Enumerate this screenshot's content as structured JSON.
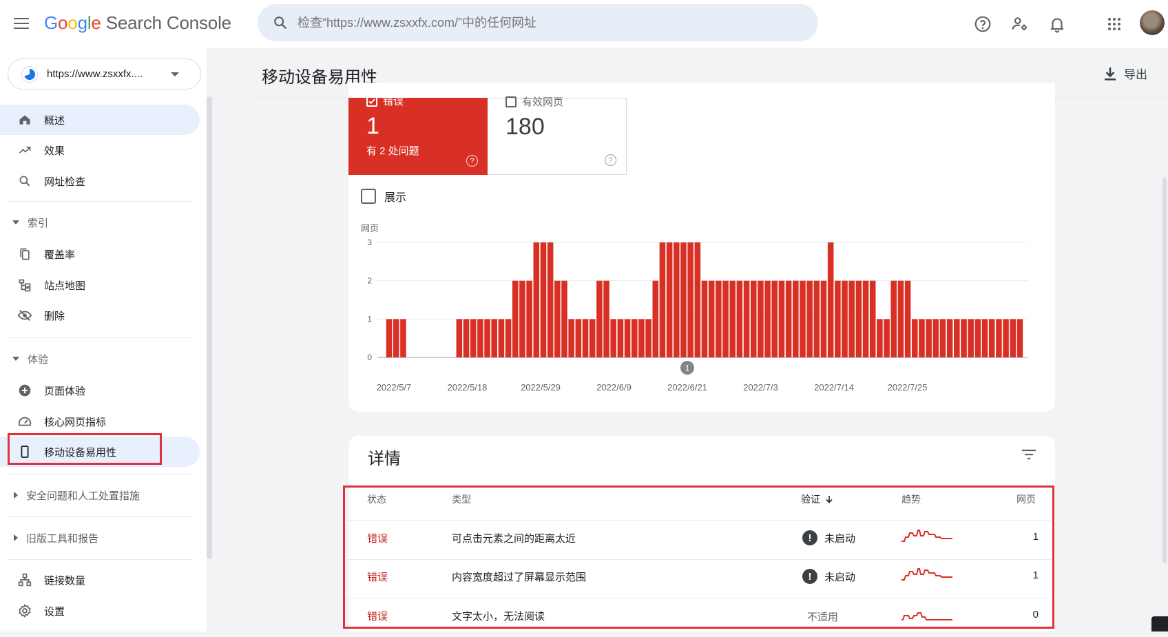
{
  "header": {
    "logo_google": [
      "G",
      "o",
      "o",
      "g",
      "l",
      "e"
    ],
    "logo_product": "Search Console",
    "search_placeholder": "检查“https://www.zsxxfx.com/”中的任何网址",
    "icons": [
      "help-icon",
      "manage-users-icon",
      "notifications-icon",
      "apps-icon"
    ]
  },
  "sidebar": {
    "property": "https://www.zsxxfx....",
    "items": [
      {
        "label": "概述",
        "icon": "home-icon"
      },
      {
        "label": "效果",
        "icon": "trending-up-icon"
      },
      {
        "label": "网址检查",
        "icon": "search-icon"
      }
    ],
    "section_index": {
      "label": "索引",
      "items": [
        {
          "label": "覆盖率",
          "icon": "copy-icon"
        },
        {
          "label": "站点地图",
          "icon": "sitemap-icon"
        },
        {
          "label": "删除",
          "icon": "visibility-off-icon"
        }
      ]
    },
    "section_experience": {
      "label": "体验",
      "items": [
        {
          "label": "页面体验",
          "icon": "add-circle-icon"
        },
        {
          "label": "核心网页指标",
          "icon": "speed-icon"
        },
        {
          "label": "移动设备易用性",
          "icon": "smartphone-icon"
        }
      ]
    },
    "section_security": "安全问题和人工处置措施",
    "section_legacy": "旧版工具和报告",
    "footer_items": [
      {
        "label": "链接数量",
        "icon": "links-icon"
      },
      {
        "label": "设置",
        "icon": "settings-icon"
      }
    ]
  },
  "main": {
    "title": "移动设备易用性",
    "export_label": "导出",
    "tiles": {
      "error": {
        "label": "错误",
        "value": "1",
        "sub": "有 2 处问题",
        "checked": true
      },
      "valid": {
        "label": "有效网页",
        "value": "180",
        "checked": false
      }
    },
    "show_label": "展示",
    "details_title": "详情"
  },
  "chart_data": {
    "type": "bar",
    "ylabel": "网页",
    "ylim": [
      0,
      3
    ],
    "yticks": [
      0,
      1,
      2,
      3
    ],
    "x_tick_labels": [
      "2022/5/7",
      "2022/5/18",
      "2022/5/29",
      "2022/6/9",
      "2022/6/21",
      "2022/7/3",
      "2022/7/14",
      "2022/7/25"
    ],
    "annotation": "1",
    "series": [
      {
        "color": "#d93025",
        "values": [
          1,
          1,
          1,
          0,
          0,
          0,
          0,
          0,
          0,
          0,
          1,
          1,
          1,
          1,
          1,
          1,
          1,
          1,
          2,
          2,
          2,
          3,
          3,
          3,
          2,
          2,
          1,
          1,
          1,
          1,
          2,
          2,
          1,
          1,
          1,
          1,
          1,
          1,
          2,
          3,
          3,
          3,
          3,
          3,
          3,
          2,
          2,
          2,
          2,
          2,
          2,
          2,
          2,
          2,
          2,
          2,
          2,
          2,
          2,
          2,
          2,
          2,
          2,
          3,
          2,
          2,
          2,
          2,
          2,
          2,
          1,
          1,
          2,
          2,
          2,
          1,
          1,
          1,
          1,
          1,
          1,
          1,
          1,
          1,
          1,
          1,
          1,
          1,
          1,
          1,
          1
        ]
      }
    ]
  },
  "table": {
    "headers": {
      "status": "状态",
      "type": "类型",
      "verify": "验证",
      "trend": "趋势",
      "pages": "网页"
    },
    "rows": [
      {
        "status": "错误",
        "type": "可点击元素之间的距离太近",
        "verify": "未启动",
        "verify_icon": true,
        "pages": "1"
      },
      {
        "status": "错误",
        "type": "内容宽度超过了屏幕显示范围",
        "verify": "未启动",
        "verify_icon": true,
        "pages": "1"
      },
      {
        "status": "错误",
        "type": "文字太小，无法阅读",
        "verify": "不适用",
        "verify_icon": false,
        "pages": "0"
      }
    ]
  },
  "colors": {
    "accent": "#1a73e8",
    "error": "#d93025",
    "highlight": "#e0303d"
  }
}
